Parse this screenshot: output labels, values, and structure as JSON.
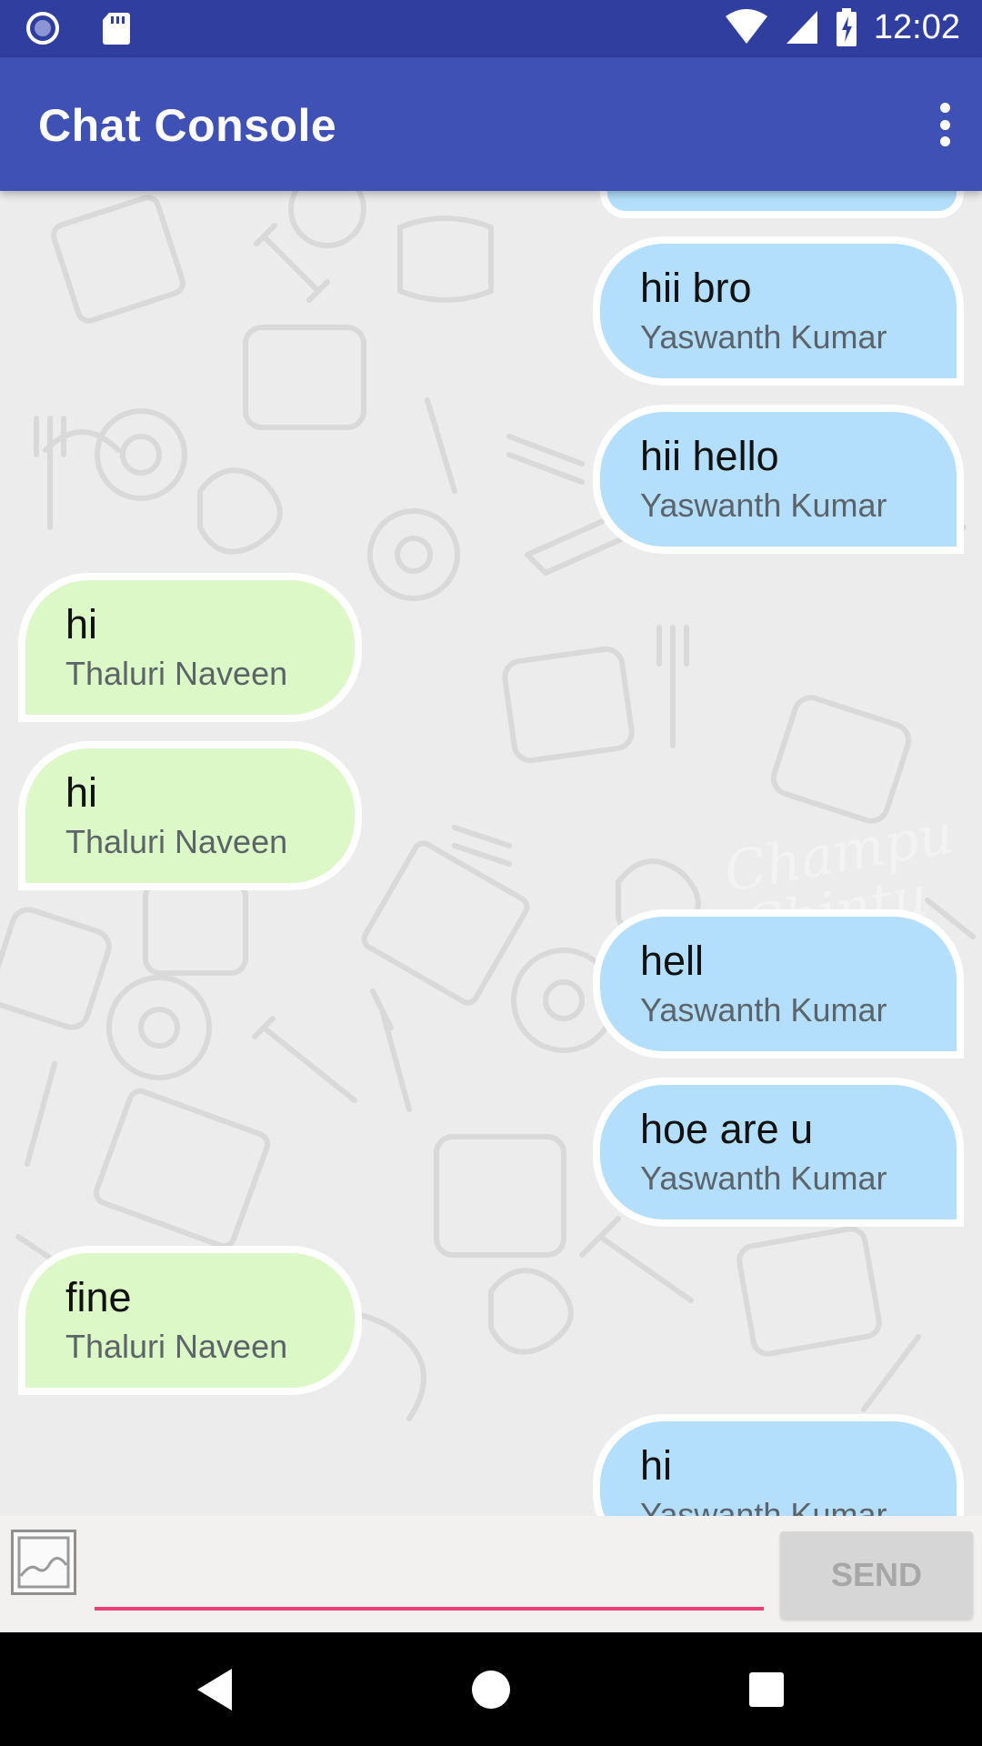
{
  "status_bar": {
    "time": "12:02",
    "icons": [
      "notification-circle-icon",
      "sd-card-icon",
      "wifi-icon",
      "cell-signal-icon",
      "battery-charging-icon"
    ]
  },
  "app_bar": {
    "title": "Chat Console",
    "menu_icon": "overflow-menu-icon"
  },
  "messages": [
    {
      "direction": "sent",
      "text": "hii bro",
      "sender": "Yaswanth Kumar"
    },
    {
      "direction": "sent",
      "text": "hii hello",
      "sender": "Yaswanth Kumar"
    },
    {
      "direction": "received",
      "text": "hi",
      "sender": "Thaluri Naveen"
    },
    {
      "direction": "received",
      "text": "hi",
      "sender": "Thaluri Naveen"
    },
    {
      "direction": "sent",
      "text": "hell",
      "sender": "Yaswanth Kumar"
    },
    {
      "direction": "sent",
      "text": "hoe are u",
      "sender": "Yaswanth Kumar"
    },
    {
      "direction": "received",
      "text": "fine",
      "sender": "Thaluri Naveen"
    },
    {
      "direction": "sent",
      "text": "hi",
      "sender": "Yaswanth Kumar"
    }
  ],
  "composer": {
    "input_value": "",
    "input_placeholder": "",
    "send_label": "SEND",
    "attach_icon": "image-icon"
  },
  "nav_bar": {
    "icons": [
      "back-icon",
      "home-icon",
      "recents-icon"
    ]
  },
  "colors": {
    "status_bar": "#303F9F",
    "app_bar": "#3F51B5",
    "sent_bubble": "#B3DFFC",
    "received_bubble": "#DCF8C6",
    "input_underline": "#EC407A"
  }
}
